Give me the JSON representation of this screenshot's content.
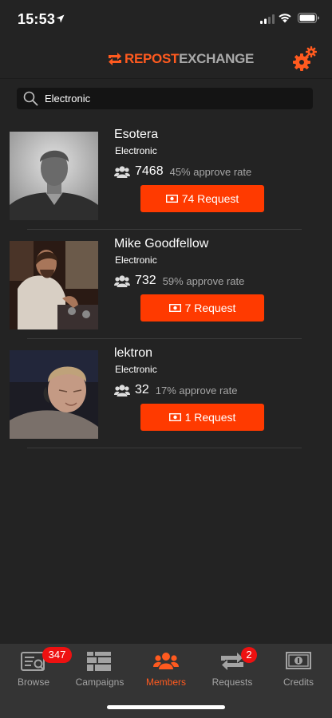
{
  "status_bar": {
    "time": "15:53"
  },
  "header": {
    "logo_part1": "REPOST",
    "logo_part2": "EXCHANGE",
    "accent": "#ff5a1f"
  },
  "search": {
    "value": "Electronic",
    "icon": "search-icon"
  },
  "members": [
    {
      "name": "Esotera",
      "genre": "Electronic",
      "followers": "7468",
      "approve_rate": "45% approve rate",
      "request_label": "74 Request"
    },
    {
      "name": "Mike Goodfellow",
      "genre": "Electronic",
      "followers": "732",
      "approve_rate": "59% approve rate",
      "request_label": "7 Request"
    },
    {
      "name": "lektron",
      "genre": "Electronic",
      "followers": "32",
      "approve_rate": "17% approve rate",
      "request_label": "1 Request"
    }
  ],
  "tabs": [
    {
      "label": "Browse",
      "icon": "browse-icon",
      "badge": "347"
    },
    {
      "label": "Campaigns",
      "icon": "campaigns-icon"
    },
    {
      "label": "Members",
      "icon": "members-icon",
      "active": true
    },
    {
      "label": "Requests",
      "icon": "requests-icon",
      "badge": "2"
    },
    {
      "label": "Credits",
      "icon": "credits-icon"
    }
  ],
  "colors": {
    "background": "#232323",
    "button": "#ff3a00",
    "badge": "#ee1111",
    "tab_bar": "#343434"
  }
}
